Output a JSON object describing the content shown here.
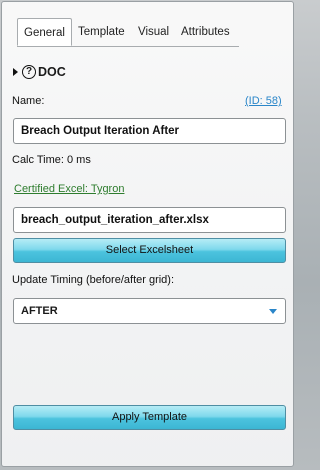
{
  "tabs": [
    {
      "label": "General"
    },
    {
      "label": "Template"
    },
    {
      "label": "Visual"
    },
    {
      "label": "Attributes"
    }
  ],
  "doc": {
    "label": "DOC",
    "help_glyph": "?"
  },
  "name": {
    "label": "Name:",
    "id_link": "(ID: 58)",
    "value": "Breach Output Iteration After"
  },
  "calc_time": "Calc Time: 0 ms",
  "excel": {
    "certified_link": "Certified Excel: Tygron",
    "file_value": "breach_output_iteration_after.xlsx",
    "select_button": "Select Excelsheet"
  },
  "update_timing": {
    "label": "Update Timing (before/after grid):",
    "selected": "AFTER"
  },
  "apply_button": "Apply Template",
  "colors": {
    "link_blue": "#2a86c9",
    "link_green": "#2e7d2e",
    "button_cyan": "#4cc3de"
  }
}
